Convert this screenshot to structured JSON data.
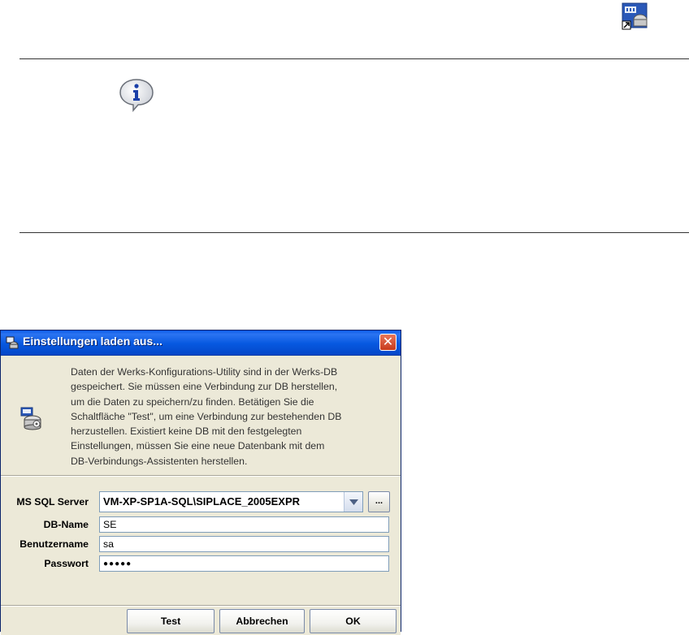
{
  "top_icon": "database-shortcut-icon",
  "info_icon": "info-bubble-icon",
  "dialog": {
    "title": "Einstellungen laden aus...",
    "close_label": "✕",
    "intro_lines": [
      "Daten der Werks-Konfigurations-Utility sind in der Werks-DB",
      "gespeichert. Sie müssen eine Verbindung zur DB herstellen,",
      "um die Daten zu speichern/zu finden. Betätigen Sie die",
      "Schaltfläche \"Test\", um eine Verbindung zur bestehenden DB",
      "herzustellen. Existiert keine DB mit den festgelegten",
      "Einstellungen, müssen Sie eine neue Datenbank mit dem",
      "DB-Verbindungs-Assistenten herstellen."
    ],
    "form": {
      "server_label": "MS SQL Server",
      "server_value": "VM-XP-SP1A-SQL\\SIPLACE_2005EXPR",
      "browse_label": "...",
      "dbname_label": "DB-Name",
      "dbname_value": "SE",
      "user_label": "Benutzername",
      "user_value": "sa",
      "password_label": "Passwort",
      "password_value": "●●●●●"
    },
    "buttons": {
      "test": "Test",
      "cancel": "Abbrechen",
      "ok": "OK"
    }
  }
}
